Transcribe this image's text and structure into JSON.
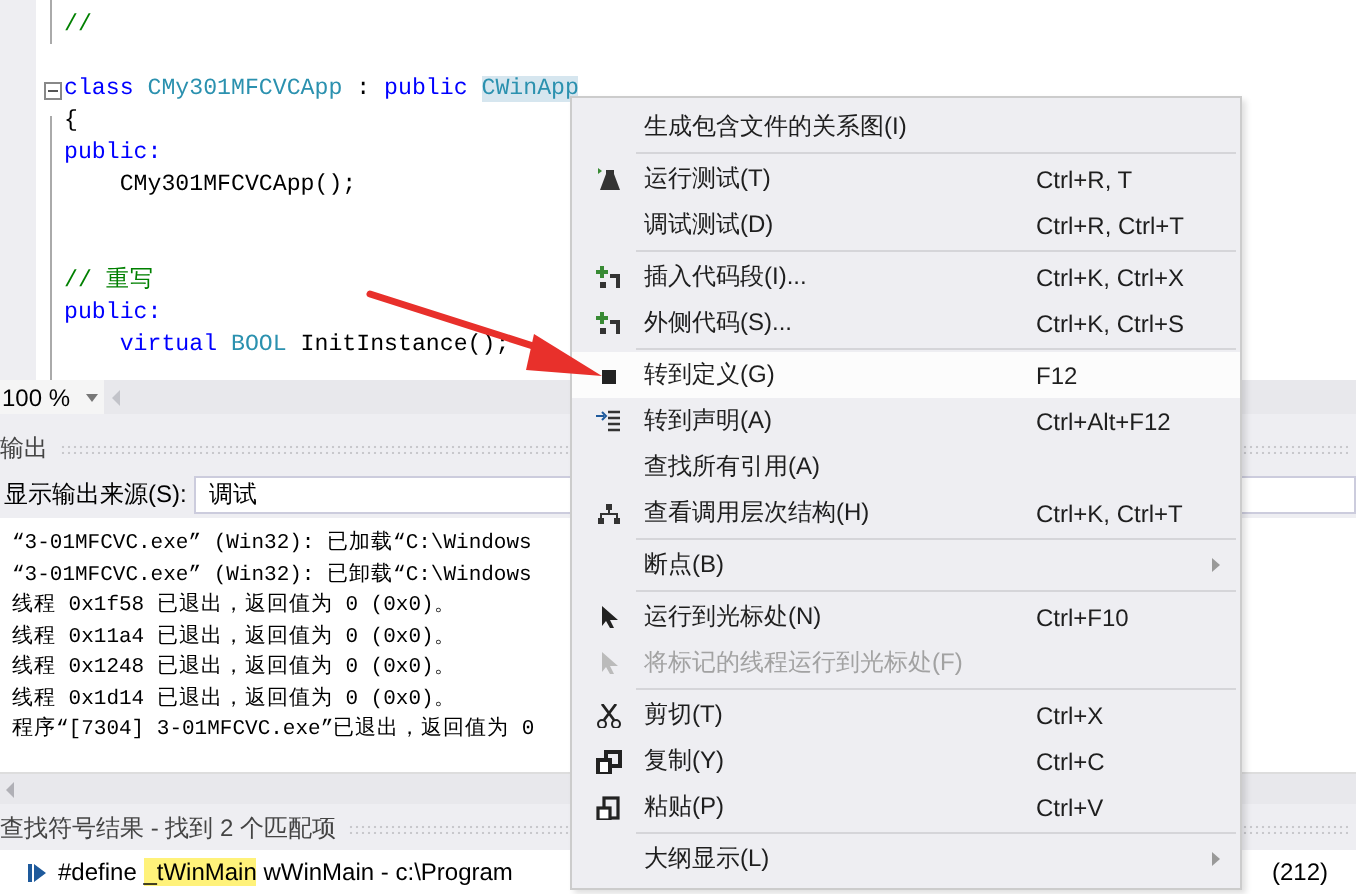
{
  "editor": {
    "lines": [
      {
        "kind": "code",
        "tokens": [
          {
            "kind": "comment",
            "text": "//"
          }
        ]
      },
      {
        "kind": "blank"
      },
      {
        "kind": "fold",
        "tokens": [
          {
            "kind": "keyword",
            "text": "class "
          },
          {
            "kind": "type",
            "text": "CMy301MFCVCApp"
          },
          {
            "kind": "plain",
            "text": " : "
          },
          {
            "kind": "keyword",
            "text": "public "
          },
          {
            "kind": "match",
            "text": "CWinApp"
          }
        ]
      },
      {
        "kind": "code",
        "tokens": [
          {
            "kind": "plain",
            "text": "{"
          }
        ]
      },
      {
        "kind": "code",
        "tokens": [
          {
            "kind": "keyword",
            "text": "public:"
          }
        ]
      },
      {
        "kind": "code",
        "tokens": [
          {
            "kind": "plain",
            "text": "    CMy301MFCVCApp();"
          }
        ]
      },
      {
        "kind": "blank"
      },
      {
        "kind": "blank"
      },
      {
        "kind": "code",
        "tokens": [
          {
            "kind": "comment",
            "text": "// 重写"
          }
        ]
      },
      {
        "kind": "code",
        "tokens": [
          {
            "kind": "keyword",
            "text": "public:"
          }
        ]
      },
      {
        "kind": "code",
        "tokens": [
          {
            "kind": "keyword",
            "text": "    virtual "
          },
          {
            "kind": "type",
            "text": "BOOL"
          },
          {
            "kind": "plain",
            "text": " InitInstance();"
          }
        ]
      }
    ]
  },
  "zoom": {
    "value": "100 %"
  },
  "output": {
    "title": "输出",
    "source_label": "显示输出来源(S):",
    "source_value": "调试",
    "lines": [
      "“3-01MFCVC.exe” (Win32): 已加载“C:\\Windows",
      "“3-01MFCVC.exe” (Win32): 已卸载“C:\\Windows",
      "线程 0x1f58 已退出，返回值为 0 (0x0)。",
      "线程 0x11a4 已退出，返回值为 0 (0x0)。",
      "线程 0x1248 已退出，返回值为 0 (0x0)。",
      "线程 0x1d14 已退出，返回值为 0 (0x0)。",
      "程序“[7304] 3-01MFCVC.exe”已退出，返回值为 0"
    ]
  },
  "find_results": {
    "title": "查找符号结果 - 找到 2 个匹配项",
    "row": {
      "tokens": [
        {
          "text": "#define ",
          "highlighted": false
        },
        {
          "text": "_tWinMain",
          "highlighted": true
        },
        {
          "text": " wWinMain - c:\\Program",
          "highlighted": false
        }
      ],
      "tail": "(212)"
    }
  },
  "context_menu": {
    "items": [
      {
        "kind": "item",
        "label": "生成包含文件的关系图(I)",
        "disabled": false,
        "selected": false,
        "submenu": false
      },
      {
        "kind": "separator"
      },
      {
        "kind": "item",
        "label": "运行测试(T)",
        "shortcut": "Ctrl+R, T",
        "disabled": false,
        "selected": false,
        "submenu": false
      },
      {
        "kind": "item",
        "label": "调试测试(D)",
        "shortcut": "Ctrl+R, Ctrl+T",
        "disabled": false,
        "selected": false,
        "submenu": false
      },
      {
        "kind": "separator"
      },
      {
        "kind": "item",
        "label": "插入代码段(I)...",
        "shortcut": "Ctrl+K, Ctrl+X",
        "disabled": false,
        "selected": false,
        "submenu": false
      },
      {
        "kind": "item",
        "label": "外侧代码(S)...",
        "shortcut": "Ctrl+K, Ctrl+S",
        "disabled": false,
        "selected": false,
        "submenu": false
      },
      {
        "kind": "separator"
      },
      {
        "kind": "item",
        "label": "转到定义(G)",
        "shortcut": "F12",
        "disabled": false,
        "selected": true,
        "submenu": false
      },
      {
        "kind": "item",
        "label": "转到声明(A)",
        "shortcut": "Ctrl+Alt+F12",
        "disabled": false,
        "selected": false,
        "submenu": false
      },
      {
        "kind": "item",
        "label": "查找所有引用(A)",
        "disabled": false,
        "selected": false,
        "submenu": false
      },
      {
        "kind": "item",
        "label": "查看调用层次结构(H)",
        "shortcut": "Ctrl+K, Ctrl+T",
        "disabled": false,
        "selected": false,
        "submenu": false
      },
      {
        "kind": "separator"
      },
      {
        "kind": "item",
        "label": "断点(B)",
        "disabled": false,
        "selected": false,
        "submenu": true
      },
      {
        "kind": "separator"
      },
      {
        "kind": "item",
        "label": "运行到光标处(N)",
        "shortcut": "Ctrl+F10",
        "disabled": false,
        "selected": false,
        "submenu": false
      },
      {
        "kind": "item",
        "label": "将标记的线程运行到光标处(F)",
        "disabled": true,
        "selected": false,
        "submenu": false
      },
      {
        "kind": "separator"
      },
      {
        "kind": "item",
        "label": "剪切(T)",
        "shortcut": "Ctrl+X",
        "disabled": false,
        "selected": false,
        "submenu": false
      },
      {
        "kind": "item",
        "label": "复制(Y)",
        "shortcut": "Ctrl+C",
        "disabled": false,
        "selected": false,
        "submenu": false
      },
      {
        "kind": "item",
        "label": "粘贴(P)",
        "shortcut": "Ctrl+V",
        "disabled": false,
        "selected": false,
        "submenu": false
      },
      {
        "kind": "separator"
      },
      {
        "kind": "item",
        "label": "大纲显示(L)",
        "disabled": false,
        "selected": false,
        "submenu": true
      }
    ]
  }
}
